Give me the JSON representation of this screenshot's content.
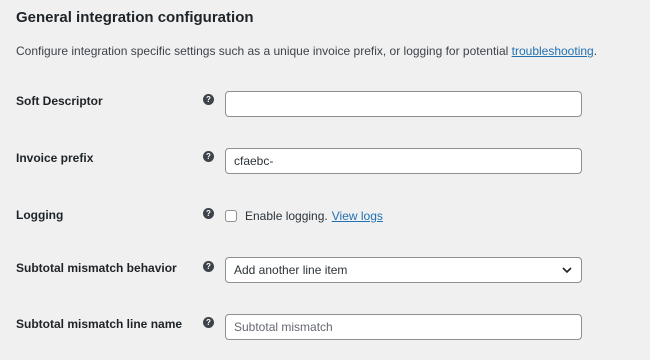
{
  "section": {
    "title": "General integration configuration",
    "description": "Configure integration specific settings such as a unique invoice prefix, or logging for potential",
    "link_text": "troubleshooting",
    "link_suffix": "."
  },
  "fields": {
    "soft_descriptor": {
      "label": "Soft Descriptor",
      "value": "",
      "help_icon": "help-icon"
    },
    "invoice_prefix": {
      "label": "Invoice prefix",
      "value": "cfaebc-",
      "help_icon": "help-icon"
    },
    "logging": {
      "label": "Logging",
      "checkbox_label": "Enable logging.",
      "link_text": "View logs",
      "checked": false
    },
    "subtotal_behavior": {
      "label": "Subtotal mismatch behavior",
      "selected": "Add another line item"
    },
    "subtotal_line_name": {
      "label": "Subtotal mismatch line name",
      "placeholder": "Subtotal mismatch"
    }
  },
  "colors": {
    "background": "#f0f0f1",
    "link": "#2271b1",
    "border": "#8c8f94"
  }
}
